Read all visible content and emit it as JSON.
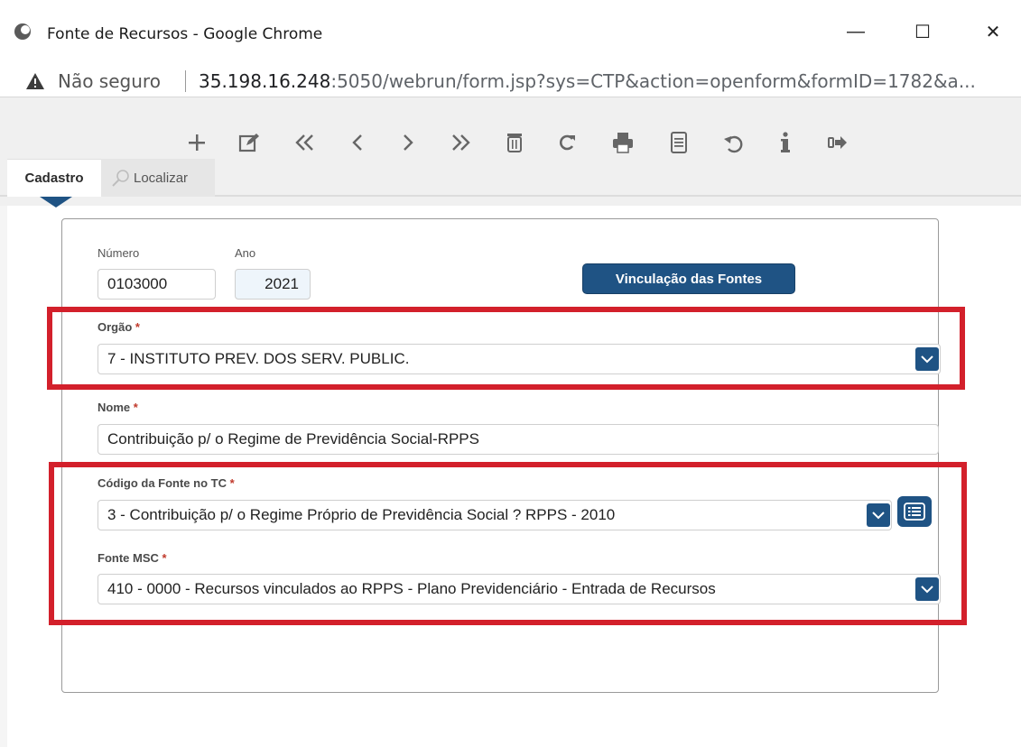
{
  "window": {
    "title": "Fonte de Recursos - Google Chrome",
    "minimize": "—",
    "maximize": "☐",
    "close": "✕"
  },
  "address": {
    "security_label": "Não seguro",
    "host": "35.198.16.248",
    "url_rest": ":5050/webrun/form.jsp?sys=CTP&action=openform&formID=1782&a..."
  },
  "toolbar": {
    "icons": [
      "plus-icon",
      "edit-icon",
      "first-record-icon",
      "previous-record-icon",
      "next-record-icon",
      "last-record-icon",
      "delete-icon",
      "refresh-icon",
      "print-icon",
      "document-icon",
      "undo-icon",
      "info-icon",
      "exit-icon"
    ]
  },
  "tabs": {
    "cadastro": "Cadastro",
    "localizar": "Localizar"
  },
  "form": {
    "numero_label": "Número",
    "numero_value": "0103000",
    "ano_label": "Ano",
    "ano_value": "2021",
    "vinculacao_button": "Vinculação das Fontes",
    "orgao_label": "Orgão",
    "orgao_value": "7 - INSTITUTO  PREV. DOS SERV. PUBLIC.",
    "nome_label": "Nome",
    "nome_value": "Contribuição p/ o Regime de Previdência Social-RPPS",
    "codigo_label": "Código da Fonte no TC",
    "codigo_value": "3 - Contribuição p/ o Regime Próprio de Previdência Social ? RPPS - 2010",
    "fonte_msc_label": "Fonte MSC",
    "fonte_msc_value": "410 - 0000 - Recursos vinculados ao RPPS - Plano Previdenciário - Entrada de Recursos",
    "required_mark": "*"
  },
  "colors": {
    "accent": "#1f5384",
    "highlight": "#d3202b",
    "required": "#c0392b"
  }
}
